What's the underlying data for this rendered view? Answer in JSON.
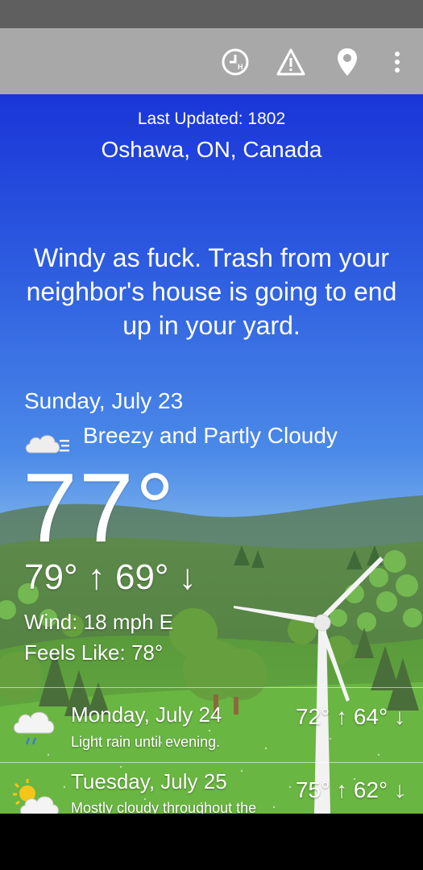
{
  "toolbar": {
    "icons": [
      "hourly-icon",
      "alert-icon",
      "location-pin-icon",
      "overflow-menu-icon"
    ]
  },
  "header": {
    "last_updated": "Last Updated: 1802",
    "location": "Oshawa, ON, Canada"
  },
  "quip": "Windy as fuck. Trash from your neighbor's house is going to end up in your yard.",
  "today": {
    "date": "Sunday, July 23",
    "condition": "Breezy and Partly Cloudy",
    "condition_icon": "breezy-partly-cloudy-icon",
    "temp": "77°",
    "hilo": "79° ↑ 69° ↓",
    "wind": "Wind: 18 mph E",
    "feels_like": "Feels Like: 78°"
  },
  "forecast": [
    {
      "date": "Monday, July 24",
      "summary": "Light rain until evening.",
      "hilo": "72° ↑ 64° ↓",
      "icon": "rain-cloud-icon"
    },
    {
      "date": "Tuesday, July 25",
      "summary": "Mostly cloudy throughout the",
      "hilo": "75° ↑ 62° ↓",
      "icon": "partly-sunny-icon"
    }
  ]
}
